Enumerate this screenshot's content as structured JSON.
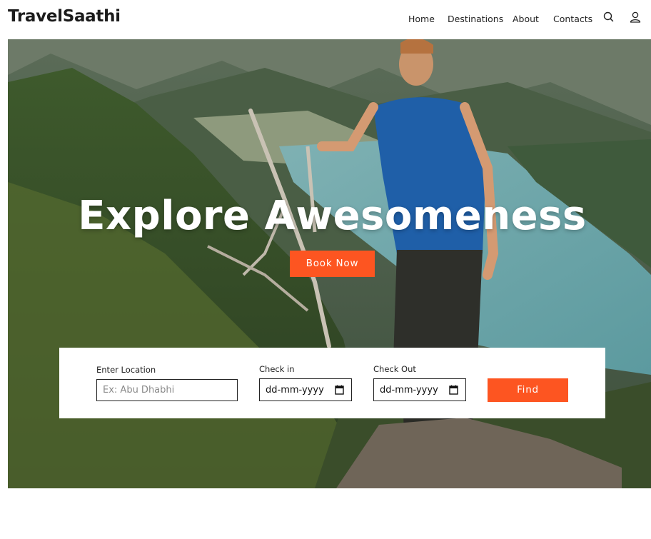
{
  "header": {
    "logo": "TravelSaathi",
    "nav": [
      "Home",
      "Destinations",
      "About",
      "Contacts"
    ],
    "icons": [
      "search-icon",
      "user-icon"
    ]
  },
  "hero": {
    "title": "Explore Awesomeness",
    "book_button": "Book Now"
  },
  "search": {
    "location_label": "Enter Location",
    "location_placeholder": "Ex: Abu Dhabhi",
    "checkin_label": "Check in",
    "checkin_value": "dd-mm-yyyy",
    "checkout_label": "Check Out",
    "checkout_value": "dd-mm-yyyy",
    "find_button": "Find"
  },
  "colors": {
    "accent": "#fd5521",
    "text": "#1b1b1b"
  }
}
